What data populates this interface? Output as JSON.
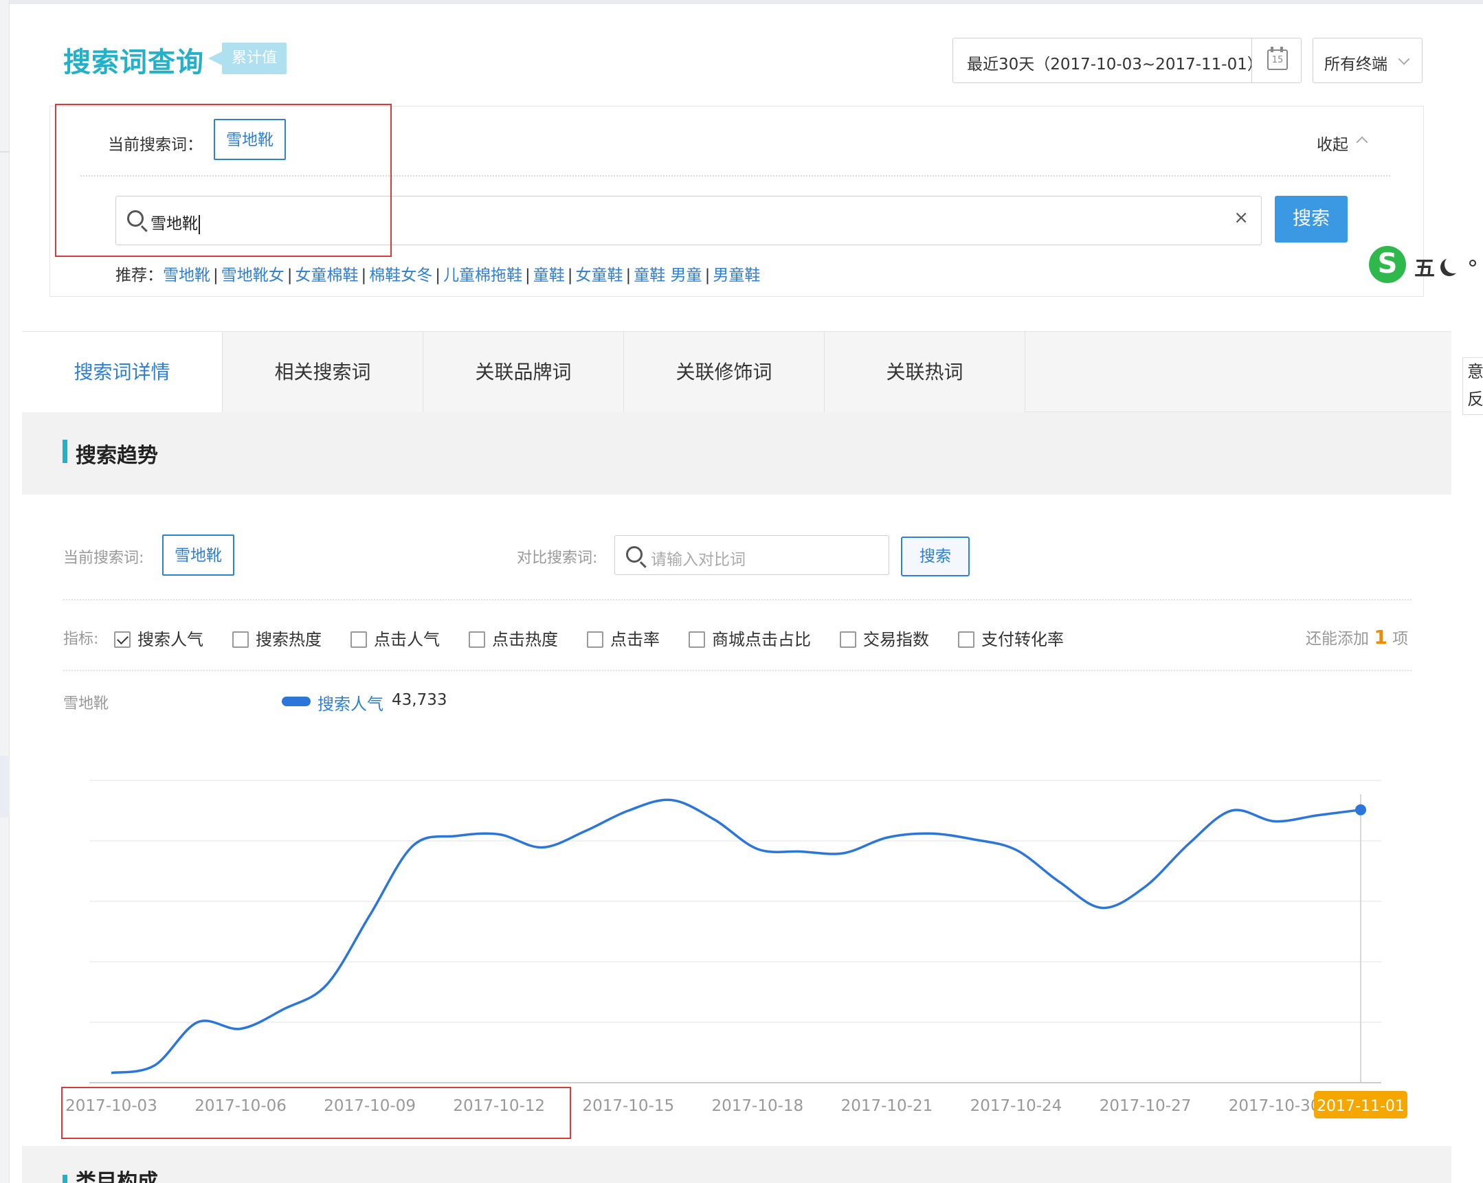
{
  "header": {
    "title": "搜索词查询",
    "tag": "累计值",
    "date_range": "最近30天（2017-10-03~2017-11-01）",
    "calendar_day": "15",
    "terminal": "所有终端"
  },
  "search_panel": {
    "current_label": "当前搜索词：",
    "current_keyword": "雪地靴",
    "collapse_label": "收起",
    "input_value": "雪地靴",
    "clear_glyph": "×",
    "search_button": "搜索",
    "recommend_label": "推荐：",
    "recommend_items": [
      "雪地靴",
      "雪地靴女",
      "女童棉鞋",
      "棉鞋女冬",
      "儿童棉拖鞋",
      "童鞋",
      "女童鞋",
      "童鞋 男童",
      "男童鞋"
    ]
  },
  "ime": {
    "logo": "S",
    "mode": "五"
  },
  "right_mini": {
    "line1": "意",
    "line2": "反"
  },
  "tabs": [
    "搜索词详情",
    "相关搜索词",
    "关联品牌词",
    "关联修饰词",
    "关联热词"
  ],
  "section": {
    "title": "搜索趋势",
    "next_title": "类目构成"
  },
  "filters": {
    "current_label": "当前搜索词:",
    "current_keyword": "雪地靴",
    "compare_label": "对比搜索词:",
    "compare_placeholder": "请输入对比词",
    "compare_button": "搜索",
    "metrics_label": "指标:",
    "metrics": [
      {
        "label": "搜索人气",
        "checked": true
      },
      {
        "label": "搜索热度",
        "checked": false
      },
      {
        "label": "点击人气",
        "checked": false
      },
      {
        "label": "点击热度",
        "checked": false
      },
      {
        "label": "点击率",
        "checked": false
      },
      {
        "label": "商城点击占比",
        "checked": false
      },
      {
        "label": "交易指数",
        "checked": false
      },
      {
        "label": "支付转化率",
        "checked": false
      }
    ],
    "add_more_prefix": "还能添加",
    "add_more_count": "1",
    "add_more_suffix": "项"
  },
  "legend": {
    "keyword": "雪地靴",
    "series_name": "搜索人气",
    "series_value": "43,733"
  },
  "chart_data": {
    "type": "line",
    "x": [
      "2017-10-03",
      "2017-10-04",
      "2017-10-05",
      "2017-10-06",
      "2017-10-07",
      "2017-10-08",
      "2017-10-09",
      "2017-10-10",
      "2017-10-11",
      "2017-10-12",
      "2017-10-13",
      "2017-10-14",
      "2017-10-15",
      "2017-10-16",
      "2017-10-17",
      "2017-10-18",
      "2017-10-19",
      "2017-10-20",
      "2017-10-21",
      "2017-10-22",
      "2017-10-23",
      "2017-10-24",
      "2017-10-25",
      "2017-10-26",
      "2017-10-27",
      "2017-10-28",
      "2017-10-29",
      "2017-10-30",
      "2017-10-31",
      "2017-11-01"
    ],
    "series": [
      {
        "name": "搜索人气",
        "color": "#2b76db",
        "values": [
          12200,
          13100,
          18400,
          17600,
          20000,
          23000,
          31500,
          40000,
          41200,
          41400,
          39800,
          41800,
          44300,
          45600,
          43200,
          39600,
          39300,
          39100,
          41000,
          41500,
          40800,
          39500,
          35600,
          32400,
          35000,
          40200,
          44300,
          43000,
          43733,
          44400
        ]
      }
    ],
    "xtick_labels": [
      "2017-10-03",
      "2017-10-06",
      "2017-10-09",
      "2017-10-12",
      "2017-10-15",
      "2017-10-18",
      "2017-10-21",
      "2017-10-24",
      "2017-10-27",
      "2017-10-30",
      "2017-11-01"
    ],
    "highlight_label": "2017-11-01",
    "highlight_color": "#f5a700",
    "ylim": [
      11000,
      48000
    ],
    "grid": true,
    "legend": "top-left"
  },
  "colors": {
    "accent": "#23b1c9",
    "link": "#2e7fd6",
    "button": "#3b98e3",
    "annotation": "#d83a3a"
  }
}
